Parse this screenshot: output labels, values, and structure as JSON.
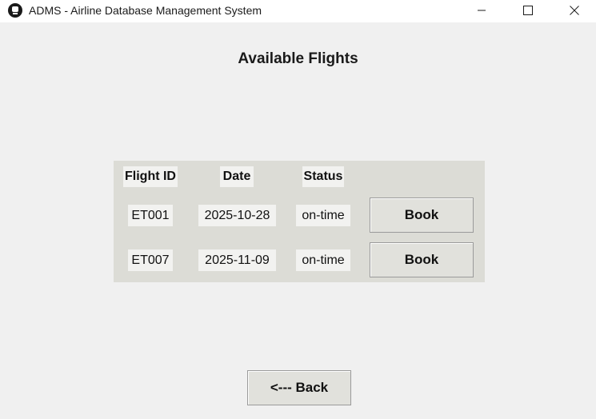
{
  "window": {
    "title": "ADMS - Airline Database Management System",
    "app_icon": "database-icon"
  },
  "page": {
    "title": "Available Flights"
  },
  "table": {
    "headers": [
      "Flight ID",
      "Date",
      "Status"
    ],
    "rows": [
      {
        "flight_id": "ET001",
        "date": "2025-10-28",
        "status": "on-time",
        "action": "Book"
      },
      {
        "flight_id": "ET007",
        "date": "2025-11-09",
        "status": "on-time",
        "action": "Book"
      }
    ]
  },
  "footer": {
    "back_label": "<--- Back"
  },
  "colors": {
    "background": "#f0f0f0",
    "panel": "#dcdcd6",
    "button": "#e1e1dc"
  }
}
